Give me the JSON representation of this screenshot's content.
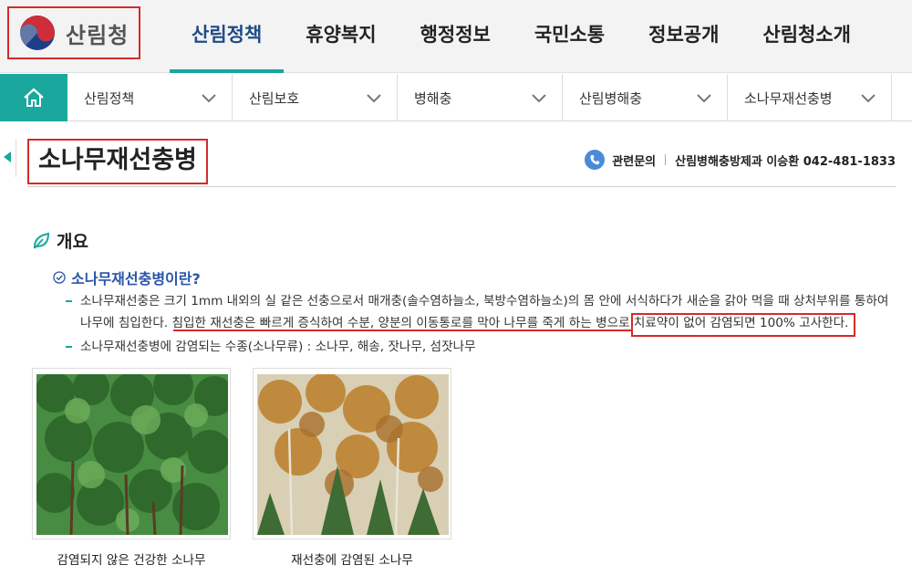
{
  "header": {
    "logo_text": "산림청",
    "nav": [
      "산림정책",
      "휴양복지",
      "행정정보",
      "국민소통",
      "정보공개",
      "산림청소개"
    ],
    "active_nav": "산림정책"
  },
  "subnav": {
    "home_icon": "home-icon",
    "items": [
      "산림정책",
      "산림보호",
      "병해충",
      "산림병해충",
      "소나무재선충병"
    ]
  },
  "page": {
    "title": "소나무재선충병",
    "contact_label": "관련문의",
    "contact_value": "산림병해충방제과 이승환 042-481-1833"
  },
  "overview": {
    "heading": "개요",
    "subheading": "소나무재선충병이란?",
    "bullet1_line1": "소나무재선충은 크기 1mm 내외의 실 같은 선충으로서 매개충(솔수염하늘소, 북방수염하늘소)의 몸 안에 서식하다가 새순을 갉아 먹을 때 상처부위를 통하여",
    "bullet1_line2": "나무에 침입한다. 침입한 재선충은 빠르게 증식하여 수분, 양분의 이동통로를 막아 나무를 죽게 하는 병으로 치료약이 없어 감염되면 100% 고사한다.",
    "bullet2": "소나무재선충병에 감염되는 수종(소나무류) : 소나무, 해송, 잣나무, 섬잣나무"
  },
  "photos": [
    {
      "caption": "감염되지 않은 건강한 소나무"
    },
    {
      "caption": "재선충에 감염된 소나무"
    }
  ],
  "colors": {
    "accent": "#1aa79e",
    "active_nav": "#1f4b86",
    "highlight_red": "#d62a2a",
    "subheading_blue": "#2a55a8"
  }
}
